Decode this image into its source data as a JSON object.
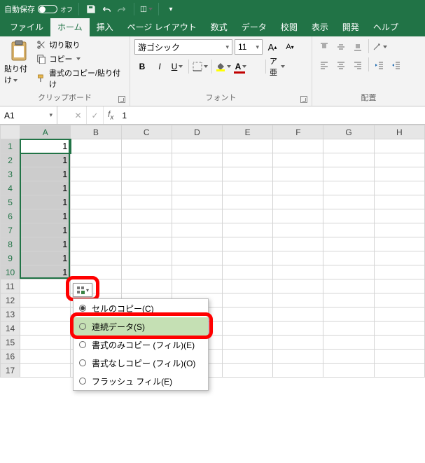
{
  "title_bar": {
    "autosave": "自動保存",
    "autosave_state": "オフ"
  },
  "tabs": {
    "file": "ファイル",
    "home": "ホーム",
    "insert": "挿入",
    "pagelayout": "ページ レイアウト",
    "formulas": "数式",
    "data": "データ",
    "review": "校閲",
    "view": "表示",
    "developer": "開発",
    "help": "ヘルプ"
  },
  "ribbon": {
    "clipboard": {
      "paste": "貼り付け",
      "cut": "切り取り",
      "copy": "コピー",
      "format_painter": "書式のコピー/貼り付け",
      "group": "クリップボード"
    },
    "font": {
      "name": "游ゴシック",
      "size": "11",
      "bold": "B",
      "italic": "I",
      "underline": "U",
      "group": "フォント"
    },
    "alignment": {
      "group": "配置"
    }
  },
  "name_box": "A1",
  "formula_bar_value": "1",
  "columns": [
    "A",
    "B",
    "C",
    "D",
    "E",
    "F",
    "G",
    "H"
  ],
  "rows_header": [
    "1",
    "2",
    "3",
    "4",
    "5",
    "6",
    "7",
    "8",
    "9",
    "10",
    "11",
    "12",
    "13",
    "14",
    "15",
    "16",
    "17"
  ],
  "cell_values": {
    "A": [
      "1",
      "1",
      "1",
      "1",
      "1",
      "1",
      "1",
      "1",
      "1",
      "1"
    ]
  },
  "autofill_menu": {
    "copy": "セルのコピー(C)",
    "series": "連続データ(S)",
    "fill_fmt": "書式のみコピー (フィル)(E)",
    "fill_nofmt": "書式なしコピー (フィル)(O)",
    "flash": "フラッシュ フィル(E)"
  }
}
